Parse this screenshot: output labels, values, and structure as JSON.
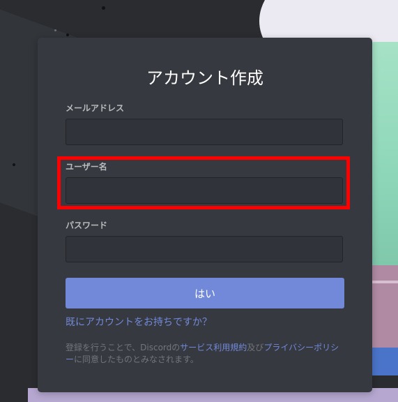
{
  "form": {
    "title": "アカウント作成",
    "email_label": "メールアドレス",
    "email_value": "",
    "username_label": "ユーザー名",
    "username_value": "",
    "password_label": "パスワード",
    "password_value": "",
    "submit_label": "はい",
    "login_link": "既にアカウントをお持ちですか？",
    "terms": {
      "prefix": "登録を行うことで、Discordの",
      "tos_link": "サービス利用規約",
      "and": "及び",
      "privacy_link": "プライバシーポリシー",
      "suffix": "に同意したものとみなされます。"
    }
  },
  "colors": {
    "card_bg": "#36393f",
    "accent": "#7289da",
    "highlight": "#ff0000",
    "input_bg": "#303339"
  }
}
